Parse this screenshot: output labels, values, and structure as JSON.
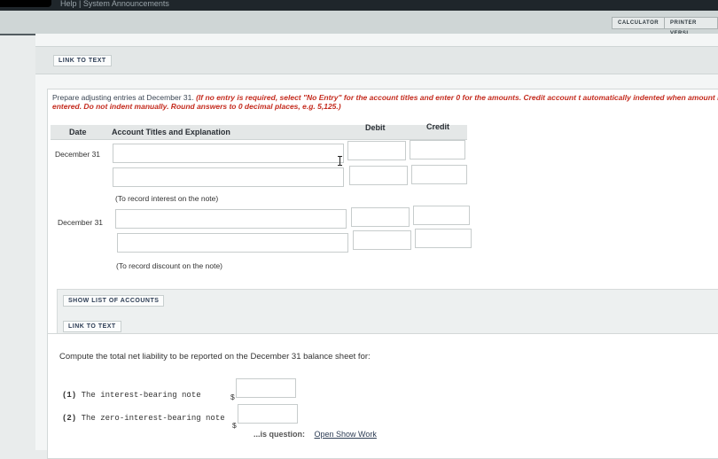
{
  "topbar": {
    "links": "Help | System Announcements"
  },
  "toolbar": {
    "calculator": "CALCULATOR",
    "printer": "PRINTER VERSI"
  },
  "link_text_top": "LINK TO TEXT",
  "instructions": {
    "plain": "Prepare adjusting entries at December 31.",
    "red": "(If no entry is required, select \"No Entry\" for the account titles and enter 0 for the amounts. Credit account t automatically indented when amount is entered. Do not indent manually. Round answers to 0 decimal places, e.g. 5,125.)"
  },
  "table": {
    "headers": {
      "date": "Date",
      "account": "Account Titles and Explanation",
      "debit": "Debit",
      "credit": "Credit"
    },
    "entries": [
      {
        "date": "December 31",
        "note": "(To record interest on the note)"
      },
      {
        "date": "December 31",
        "note": "(To record discount on the note)"
      }
    ]
  },
  "buttons": {
    "show_accounts": "SHOW LIST OF ACCOUNTS",
    "link_text": "LINK TO TEXT"
  },
  "compute": {
    "prompt": "Compute the total net liability to be reported on the December 31 balance sheet for:",
    "items": [
      {
        "num": "(1)",
        "label": "The interest-bearing note",
        "currency": "$"
      },
      {
        "num": "(2)",
        "label": "The zero-interest-bearing note",
        "currency": "$"
      }
    ]
  },
  "footer": {
    "question": "...is question:",
    "open_show_work": "Open Show Work"
  }
}
